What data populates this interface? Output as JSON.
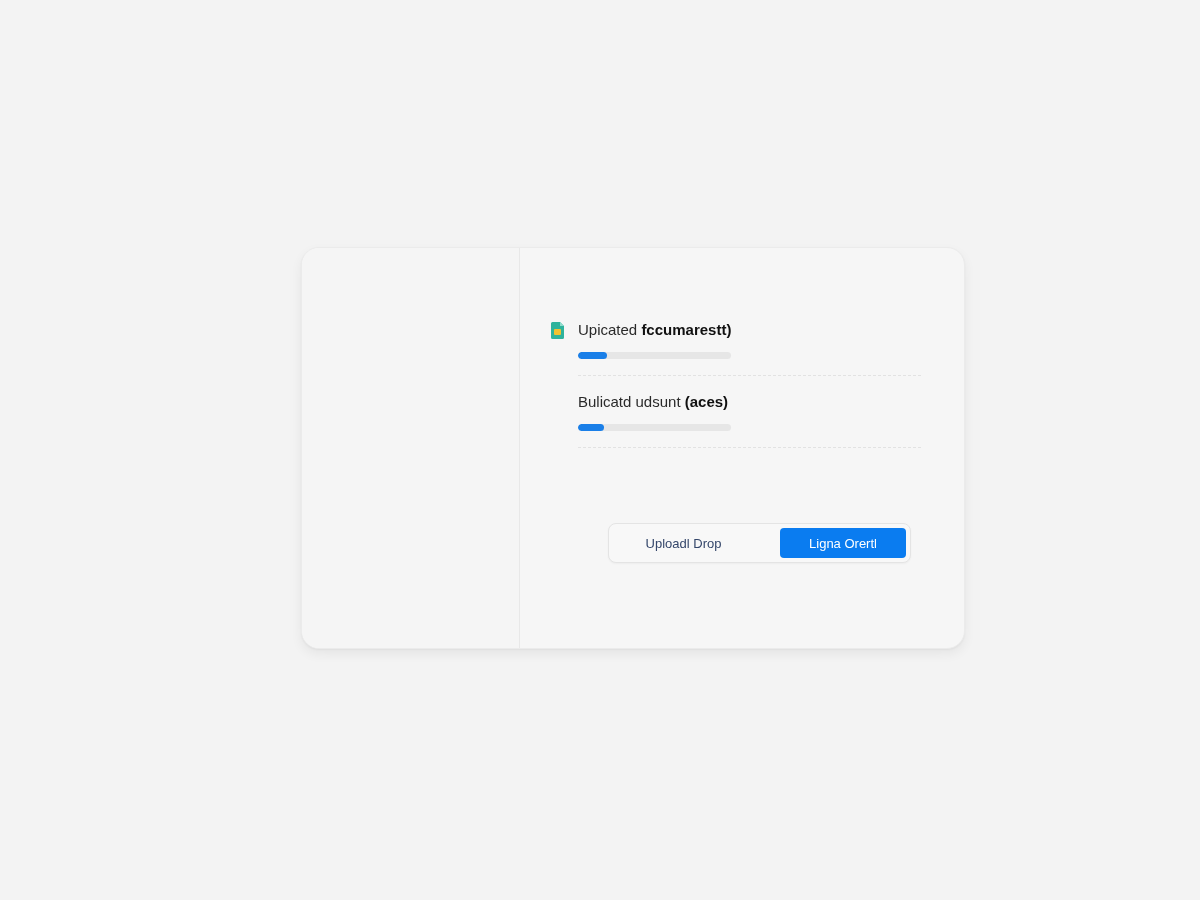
{
  "uploads": [
    {
      "kind": "file",
      "title": "Upicated **fccumarestt)**",
      "level": 0.19
    },
    {
      "kind": "plain",
      "title": "Bulicatd udsunt **(aces)**",
      "level": 0.17
    }
  ],
  "segmented_control": {
    "options": [
      {
        "label": "Uploadl Drop",
        "selected": false
      },
      {
        "label": "Ligna Orertl",
        "selected": true
      }
    ]
  }
}
